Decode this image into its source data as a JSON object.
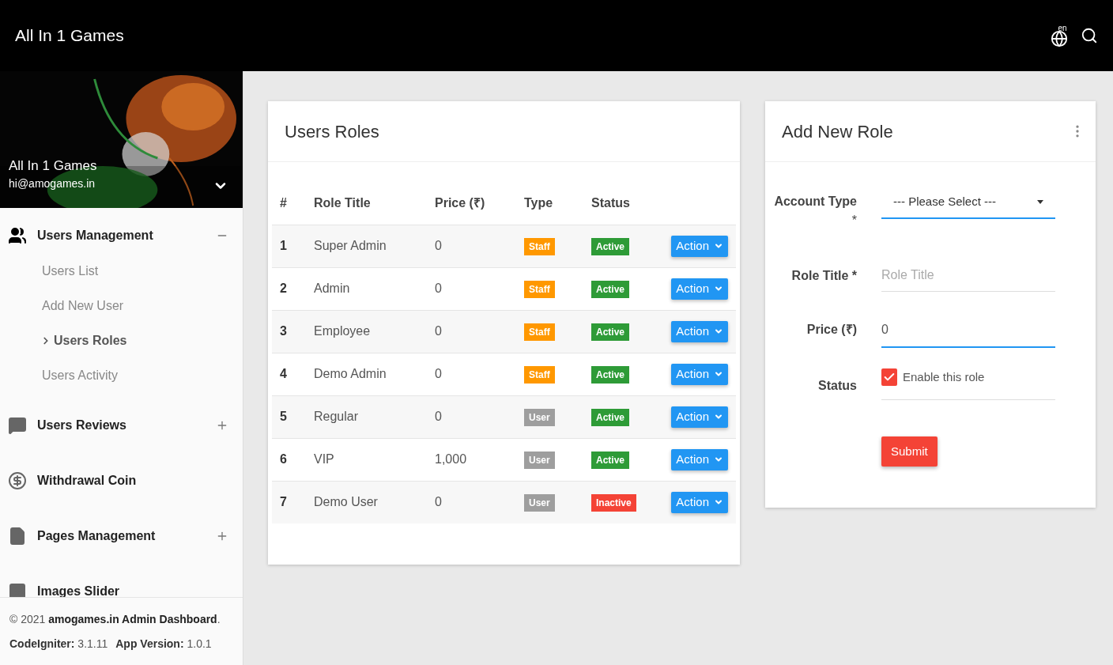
{
  "header": {
    "title": "All In 1 Games",
    "language": "en"
  },
  "profile": {
    "name": "All In 1 Games",
    "email": "hi@amogames.in"
  },
  "sidebar": {
    "items": [
      {
        "label": "Users Management",
        "kind": "group",
        "expanded": true,
        "children": [
          {
            "label": "Users List",
            "selected": false
          },
          {
            "label": "Add New User",
            "selected": false
          },
          {
            "label": "Users Roles",
            "selected": true
          },
          {
            "label": "Users Activity",
            "selected": false
          }
        ]
      },
      {
        "label": "Users Reviews",
        "kind": "group",
        "expanded": false
      },
      {
        "label": "Withdrawal Coin",
        "kind": "link"
      },
      {
        "label": "Pages Management",
        "kind": "group",
        "expanded": false
      },
      {
        "label": "Images Slider",
        "kind": "link"
      }
    ]
  },
  "footer": {
    "copyright": "© 2021 **amogames.in Admin Dashboard**.",
    "framework_label": "CodeIgniter:",
    "framework_version": "3.1.11",
    "version_label": "App Version:",
    "version": "1.0.1"
  },
  "roles_card": {
    "title": "Users Roles",
    "columns": [
      "#",
      "Role Title",
      "Price (₹)",
      "Type",
      "Status"
    ],
    "rows": [
      {
        "index": "1",
        "title": "Super Admin",
        "price": "0",
        "type": {
          "label": "Staff",
          "color": "#ff9800"
        },
        "status": {
          "label": "Active",
          "color": "#2e9b37"
        },
        "action": "Action"
      },
      {
        "index": "2",
        "title": "Admin",
        "price": "0",
        "type": {
          "label": "Staff",
          "color": "#ff9800"
        },
        "status": {
          "label": "Active",
          "color": "#2e9b37"
        },
        "action": "Action"
      },
      {
        "index": "3",
        "title": "Employee",
        "price": "0",
        "type": {
          "label": "Staff",
          "color": "#ff9800"
        },
        "status": {
          "label": "Active",
          "color": "#2e9b37"
        },
        "action": "Action"
      },
      {
        "index": "4",
        "title": "Demo Admin",
        "price": "0",
        "type": {
          "label": "Staff",
          "color": "#ff9800"
        },
        "status": {
          "label": "Active",
          "color": "#2e9b37"
        },
        "action": "Action"
      },
      {
        "index": "5",
        "title": "Regular",
        "price": "0",
        "type": {
          "label": "User",
          "color": "#9e9e9e"
        },
        "status": {
          "label": "Active",
          "color": "#2e9b37"
        },
        "action": "Action"
      },
      {
        "index": "6",
        "title": "VIP",
        "price": "1,000",
        "type": {
          "label": "User",
          "color": "#9e9e9e"
        },
        "status": {
          "label": "Active",
          "color": "#2e9b37"
        },
        "action": "Action"
      },
      {
        "index": "7",
        "title": "Demo User",
        "price": "0",
        "type": {
          "label": "User",
          "color": "#9e9e9e"
        },
        "status": {
          "label": "Inactive",
          "color": "#f44336"
        },
        "action": "Action"
      }
    ]
  },
  "add_role_card": {
    "title": "Add New Role",
    "account_type": {
      "label": "Account Type",
      "required_mark": "*",
      "value": "--- Please Select ---"
    },
    "role_title": {
      "label": "Role Title *",
      "placeholder": "Role Title"
    },
    "price": {
      "label": "Price (₹)",
      "value": "0"
    },
    "status": {
      "label": "Status",
      "checkbox_label": "Enable this role",
      "checked": true
    },
    "submit": "Submit"
  }
}
